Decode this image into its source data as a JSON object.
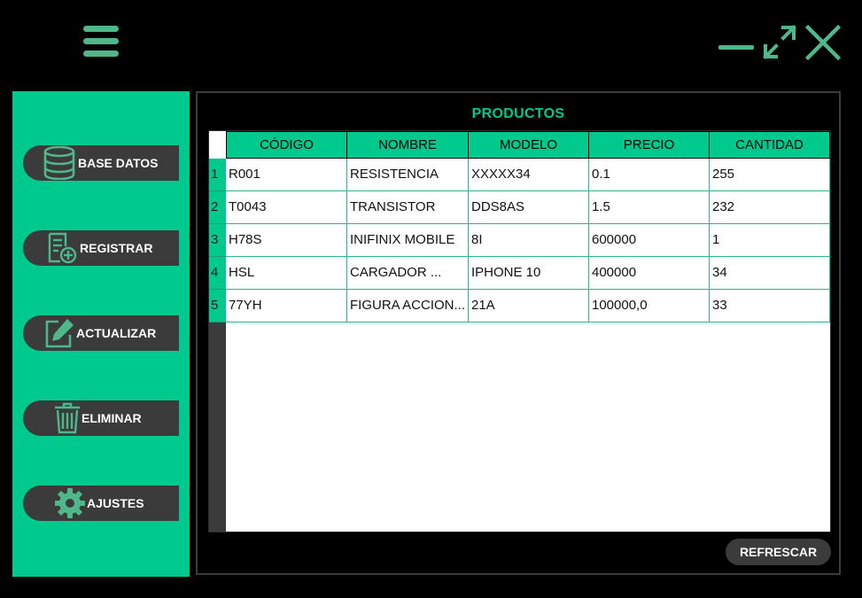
{
  "window": {
    "controls": [
      {
        "name": "minimize",
        "icon": "minimize-icon"
      },
      {
        "name": "maximize",
        "icon": "expand-arrows-icon"
      },
      {
        "name": "close",
        "icon": "close-x-icon"
      }
    ],
    "menu_icon": "hamburger-menu-icon"
  },
  "sidebar": {
    "items": [
      {
        "label": "BASE DATOS",
        "icon": "database-icon"
      },
      {
        "label": "REGISTRAR",
        "icon": "document-add-icon"
      },
      {
        "label": "ACTUALIZAR",
        "icon": "edit-icon"
      },
      {
        "label": "ELIMINAR",
        "icon": "trash-icon"
      },
      {
        "label": "AJUSTES",
        "icon": "gear-icon"
      }
    ]
  },
  "main": {
    "title": "PRODUCTOS",
    "table": {
      "columns": [
        "CÓDIGO",
        "NOMBRE",
        "MODELO",
        "PRECIO",
        "CANTIDAD"
      ],
      "rows": [
        {
          "num": "1",
          "cells": [
            "R001",
            "RESISTENCIA",
            "XXXXX34",
            "0.1",
            "255"
          ]
        },
        {
          "num": "2",
          "cells": [
            "T0043",
            "TRANSISTOR",
            "DDS8AS",
            "1.5",
            "232"
          ]
        },
        {
          "num": "3",
          "cells": [
            "H78S",
            "INIFINIX MOBILE",
            "8I",
            "600000",
            "1"
          ]
        },
        {
          "num": "4",
          "cells": [
            "HSL",
            "CARGADOR ...",
            "IPHONE 10",
            "400000",
            "34"
          ]
        },
        {
          "num": "5",
          "cells": [
            "77YH",
            "FIGURA ACCION...",
            "21A",
            "100000,0",
            "33"
          ]
        }
      ]
    },
    "refresh_label": "REFRESCAR"
  },
  "colors": {
    "accent": "#00c98e",
    "icon_green": "#4fb88b",
    "button_dark": "#3b3b3b",
    "background": "#000000"
  }
}
